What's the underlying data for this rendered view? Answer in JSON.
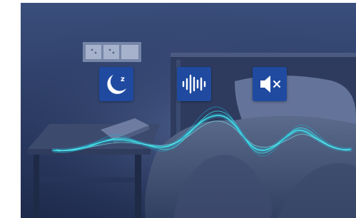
{
  "scene": {
    "colors": {
      "overlay": "#26355d",
      "tile": "#1f4aa0",
      "wave_primary": "#3fe0e6",
      "wave_secondary": "#2fb4d4",
      "icon_fg": "#ffffff"
    }
  },
  "icons": [
    {
      "name": "sleep-moon-icon",
      "badge": "z"
    },
    {
      "name": "sound-wave-icon"
    },
    {
      "name": "speaker-mute-icon"
    }
  ]
}
